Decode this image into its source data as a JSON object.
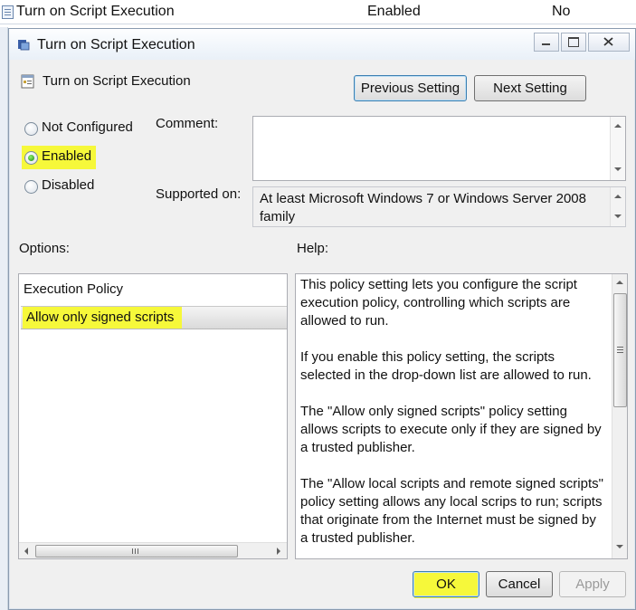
{
  "background_row": {
    "name": "Turn on Script Execution",
    "state": "Enabled",
    "comment": "No"
  },
  "dialog": {
    "window_title": "Turn on Script Execution",
    "header_title": "Turn on Script Execution",
    "previous_label": "Previous Setting",
    "next_label": "Next Setting",
    "radio_options": [
      "Not Configured",
      "Enabled",
      "Disabled"
    ],
    "selected_option": "Enabled",
    "comment_label": "Comment:",
    "comment_value": "",
    "supported_label": "Supported on:",
    "supported_line1": "At least Microsoft Windows 7 or Windows Server 2008",
    "supported_line2": "family",
    "options_label": "Options:",
    "help_label": "Help:",
    "execution_policy_label": "Execution Policy",
    "execution_policy_value": "Allow only signed scripts",
    "help_lines": [
      "This policy setting lets you configure the script",
      "execution policy, controlling which scripts are",
      "allowed to run.",
      "If you enable this policy setting, the scripts",
      "selected in the drop-down list are allowed to run.",
      "The \"Allow only signed scripts\" policy setting",
      "allows scripts to execute only if they are signed by",
      "a trusted publisher.",
      "The \"Allow local scripts and remote signed scripts\"",
      "policy setting allows any local scrips to run; scripts",
      "that originate from the Internet must be signed by",
      "a trusted publisher."
    ],
    "ok_label": "OK",
    "cancel_label": "Cancel",
    "apply_label": "Apply"
  },
  "colors": {
    "highlight": "#f6f83a",
    "dialog_bg": "#f0f0f0",
    "focus_border": "#3c7fb1"
  }
}
